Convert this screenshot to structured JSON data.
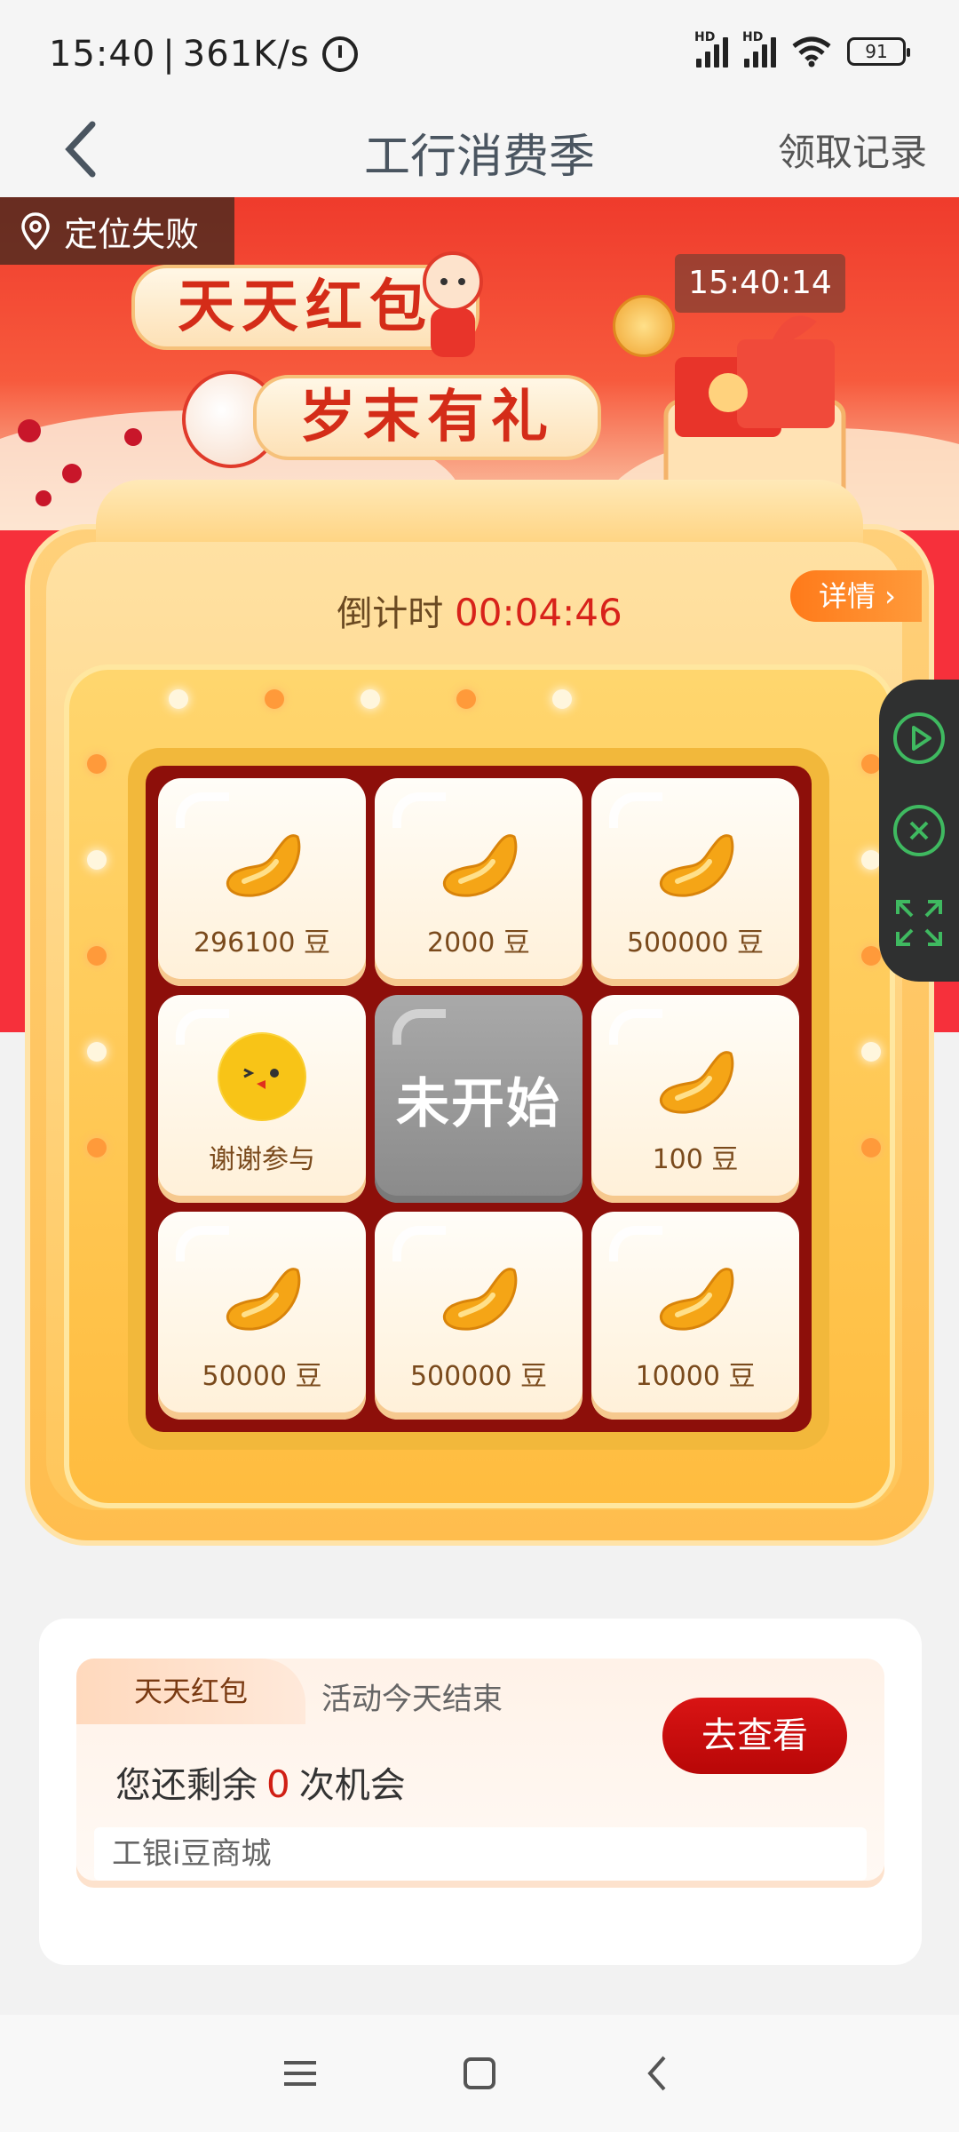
{
  "status": {
    "time": "15:40",
    "speed": "361K/s",
    "battery": "91",
    "hd1": "HD",
    "hd2": "HD"
  },
  "nav": {
    "title": "工行消费季",
    "right_link": "领取记录"
  },
  "banner": {
    "location": "定位失败",
    "pill1": "天天红包",
    "pill2": "岁末有礼",
    "clock": "15:40:14"
  },
  "game": {
    "countdown_label": "倒计时",
    "countdown_value": "00:04:46",
    "details": "详情 ›",
    "cells": [
      {
        "label": "296100 豆",
        "icon": "bean-icon"
      },
      {
        "label": "2000 豆",
        "icon": "bean-icon"
      },
      {
        "label": "500000 豆",
        "icon": "bean-icon"
      },
      {
        "label": "谢谢参与",
        "icon": "chick-icon"
      },
      {
        "label": "未开始",
        "icon": "start-button"
      },
      {
        "label": "100 豆",
        "icon": "bean-icon"
      },
      {
        "label": "50000 豆",
        "icon": "bean-icon"
      },
      {
        "label": "500000 豆",
        "icon": "bean-icon"
      },
      {
        "label": "10000 豆",
        "icon": "bean-icon"
      }
    ]
  },
  "card": {
    "tag": "天天红包",
    "note": "活动今天结束",
    "remain_prefix": "您还剩余",
    "remain_count": "0",
    "remain_suffix": "次机会",
    "button": "去查看",
    "mall": "工银i豆商城"
  },
  "colors": {
    "accent_red": "#d01f14",
    "banner_red": "#ef3b2c",
    "gold": "#ffc65a"
  }
}
